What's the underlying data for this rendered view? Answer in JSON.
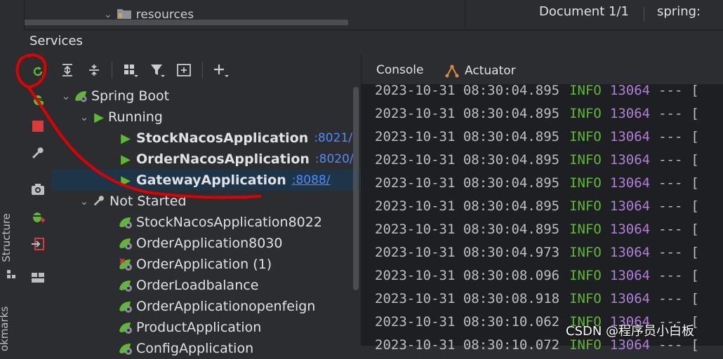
{
  "top": {
    "tree_item": "resources",
    "document_label": "Document 1/1",
    "spring_label": "spring:"
  },
  "left_strip": {
    "structure": "Structure",
    "bookmarks": "okmarks"
  },
  "services": {
    "title": "Services"
  },
  "toolbar": {
    "icons": [
      "expand-all-icon",
      "collapse-all-icon",
      "group-icon",
      "filter-icon",
      "new-service-icon",
      "add-icon"
    ]
  },
  "tree": {
    "spring_boot": "Spring Boot",
    "running": "Running",
    "running_apps": [
      {
        "name": "StockNacosApplication",
        "port": ":8021/"
      },
      {
        "name": "OrderNacosApplication",
        "port": ":8020/"
      },
      {
        "name": "GatewayApplication",
        "port": ":8088/"
      }
    ],
    "not_started": "Not Started",
    "stopped_apps": [
      "StockNacosApplication8022",
      "OrderApplication8030",
      "OrderApplication (1)",
      "OrderLoadbalance",
      "OrderApplicationopenfeign",
      "ProductApplication",
      "ConfigApplication"
    ]
  },
  "console": {
    "tabs": [
      "Console",
      "Actuator"
    ],
    "logs": [
      {
        "ts": "2023-10-31 08:30:04.895",
        "level": "INFO",
        "pid": "13064",
        "dash": "---",
        "br": "["
      },
      {
        "ts": "2023-10-31 08:30:04.895",
        "level": "INFO",
        "pid": "13064",
        "dash": "---",
        "br": "["
      },
      {
        "ts": "2023-10-31 08:30:04.895",
        "level": "INFO",
        "pid": "13064",
        "dash": "---",
        "br": "["
      },
      {
        "ts": "2023-10-31 08:30:04.895",
        "level": "INFO",
        "pid": "13064",
        "dash": "---",
        "br": "["
      },
      {
        "ts": "2023-10-31 08:30:04.895",
        "level": "INFO",
        "pid": "13064",
        "dash": "---",
        "br": "["
      },
      {
        "ts": "2023-10-31 08:30:04.895",
        "level": "INFO",
        "pid": "13064",
        "dash": "---",
        "br": "["
      },
      {
        "ts": "2023-10-31 08:30:04.895",
        "level": "INFO",
        "pid": "13064",
        "dash": "---",
        "br": "["
      },
      {
        "ts": "2023-10-31 08:30:04.973",
        "level": "INFO",
        "pid": "13064",
        "dash": "---",
        "br": "["
      },
      {
        "ts": "2023-10-31 08:30:08.096",
        "level": "INFO",
        "pid": "13064",
        "dash": "---",
        "br": "["
      },
      {
        "ts": "2023-10-31 08:30:08.918",
        "level": "INFO",
        "pid": "13064",
        "dash": "---",
        "br": "["
      },
      {
        "ts": "2023-10-31 08:30:10.062",
        "level": "INFO",
        "pid": "13064",
        "dash": "---",
        "br": "["
      },
      {
        "ts": "2023-10-31 08:30:10.072",
        "level": "INFO",
        "pid": "13064",
        "dash": "---",
        "br": "["
      }
    ]
  },
  "watermark": "CSDN @程序员小白板",
  "colors": {
    "accent": "#548af7",
    "run_green": "#5fb832",
    "pid_purple": "#b07fd6",
    "annotation_red": "#e00000"
  }
}
